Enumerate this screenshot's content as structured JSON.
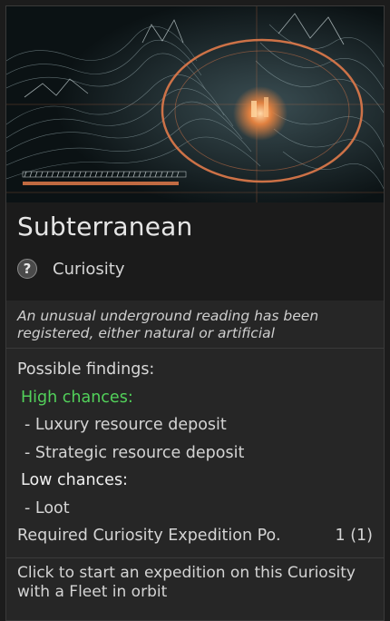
{
  "title": "Subterranean",
  "category": {
    "icon": "question-mark-icon",
    "label": "Curiosity"
  },
  "description": "An unusual underground reading has been registered, either natural or artificial",
  "findings": {
    "heading": "Possible findings:",
    "high_label": "High chances:",
    "high_items": [
      "- Luxury resource deposit",
      "- Strategic resource deposit"
    ],
    "low_label": "Low chances:",
    "low_items": [
      "- Loot"
    ]
  },
  "requirement": {
    "label": "Required Curiosity Expedition Po.",
    "value": "1 (1)"
  },
  "hint": "Click to start an expedition on this Curiosity with a Fleet in orbit",
  "colors": {
    "high_chance": "#52d15a",
    "accent_orange": "#e07a4a"
  }
}
